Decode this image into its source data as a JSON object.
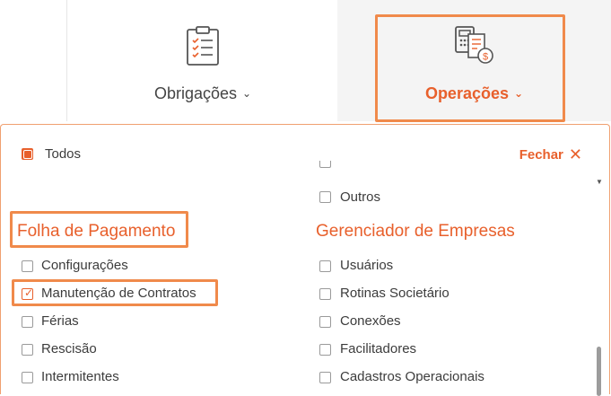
{
  "tabs": [
    {
      "label": "Obrigações",
      "icon": "clipboard-checklist-icon"
    },
    {
      "label": "Operações",
      "icon": "calculator-dollar-icon"
    }
  ],
  "filter": {
    "all_label": "Todos",
    "close_label": "Fechar"
  },
  "right_column": {
    "items_above": [
      {
        "label": "Outros",
        "checked": false
      }
    ],
    "group_title": "Gerenciador de Empresas",
    "items": [
      {
        "label": "Usuários",
        "checked": false
      },
      {
        "label": "Rotinas Societário",
        "checked": false
      },
      {
        "label": "Conexões",
        "checked": false
      },
      {
        "label": "Facilitadores",
        "checked": false
      },
      {
        "label": "Cadastros Operacionais",
        "checked": false
      }
    ]
  },
  "left_column": {
    "group_title": "Folha de Pagamento",
    "items": [
      {
        "label": "Configurações",
        "checked": false
      },
      {
        "label": "Manutenção de Contratos",
        "checked": true
      },
      {
        "label": "Férias",
        "checked": false
      },
      {
        "label": "Rescisão",
        "checked": false
      },
      {
        "label": "Intermitentes",
        "checked": false
      }
    ]
  },
  "colors": {
    "accent": "#e8602c",
    "highlight": "#f08a4b"
  }
}
